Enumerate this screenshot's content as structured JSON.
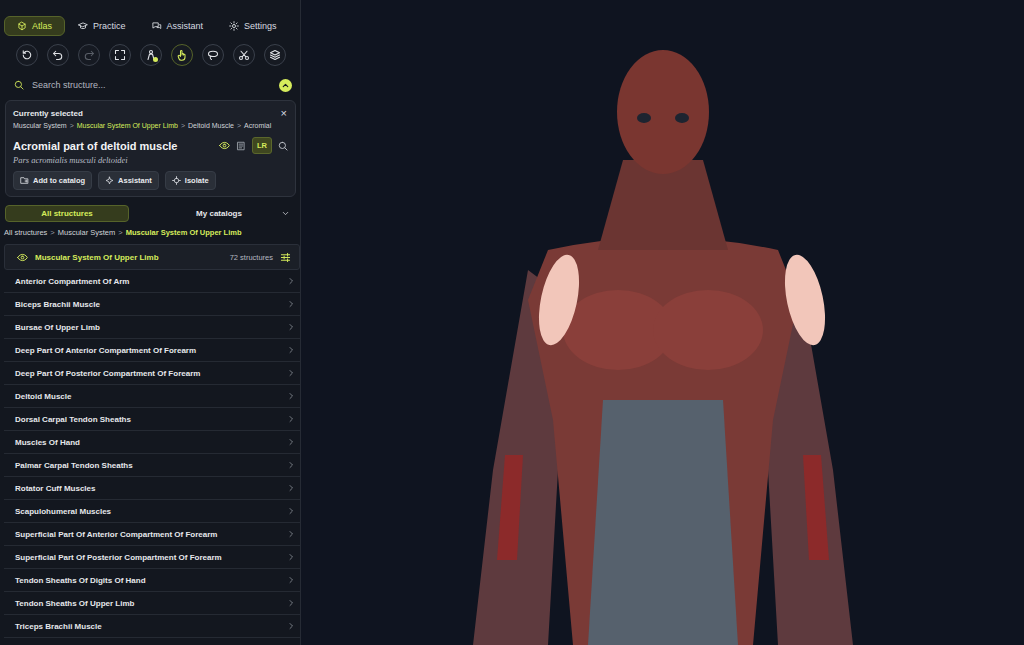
{
  "nav": {
    "tabs": [
      {
        "label": "Atlas",
        "selected": true
      },
      {
        "label": "Practice",
        "selected": false
      },
      {
        "label": "Assistant",
        "selected": false
      },
      {
        "label": "Settings",
        "selected": false
      }
    ]
  },
  "toolbar": {
    "tools": [
      {
        "active": false,
        "disabled": false,
        "marked": false
      },
      {
        "active": false,
        "disabled": false,
        "marked": false
      },
      {
        "active": false,
        "disabled": true,
        "marked": false
      },
      {
        "active": false,
        "disabled": false,
        "marked": false
      },
      {
        "active": false,
        "disabled": false,
        "marked": true
      },
      {
        "active": true,
        "disabled": false,
        "marked": false
      },
      {
        "active": false,
        "disabled": false,
        "marked": false
      },
      {
        "active": false,
        "disabled": false,
        "marked": false
      },
      {
        "active": false,
        "disabled": false,
        "marked": false
      }
    ]
  },
  "search": {
    "placeholder": "Search structure...",
    "expanded": true
  },
  "selection": {
    "heading": "Currently selected",
    "close": "×",
    "separator": ">",
    "breadcrumb": [
      {
        "label": "Muscular System",
        "highlighted": false
      },
      {
        "label": "Muscular System Of Upper Limb",
        "highlighted": true
      },
      {
        "label": "Deltoid Muscle",
        "highlighted": false
      },
      {
        "label": "Acromial",
        "highlighted": false
      }
    ],
    "title": "Acromial part of deltoid muscle",
    "latin": "Pars acromialis musculi deltoidei",
    "visible": true,
    "side": "LR",
    "actions": [
      "Add to catalog",
      "Assistant",
      "Isolate"
    ]
  },
  "scope_tabs": [
    {
      "label": "All structures",
      "selected": true
    },
    {
      "label": "My catalogs",
      "selected": false
    }
  ],
  "path": {
    "separator": ">",
    "items": [
      {
        "label": "All structures",
        "current": false
      },
      {
        "label": "Muscular System",
        "current": false
      },
      {
        "label": "Muscular System Of Upper Limb",
        "current": true
      }
    ]
  },
  "group": {
    "title": "Muscular System Of Upper Limb",
    "count": "72 structures",
    "visible": true
  },
  "items": [
    "Anterior Compartment Of Arm",
    "Biceps Brachii Muscle",
    "Bursae Of Upper Limb",
    "Deep Part Of Anterior Compartment Of Forearm",
    "Deep Part Of Posterior Compartment Of Forearm",
    "Deltoid Muscle",
    "Dorsal Carpal Tendon Sheaths",
    "Muscles Of Hand",
    "Palmar Carpal Tendon Sheaths",
    "Rotator Cuff Muscles",
    "Scapulohumeral Muscles",
    "Superficial Part Of Anterior Compartment Of Forearm",
    "Superficial Part Of Posterior Compartment Of Forearm",
    "Tendon Sheaths Of Digits Of Hand",
    "Tendon Sheaths Of Upper Limb",
    "Triceps Brachii Muscle"
  ]
}
